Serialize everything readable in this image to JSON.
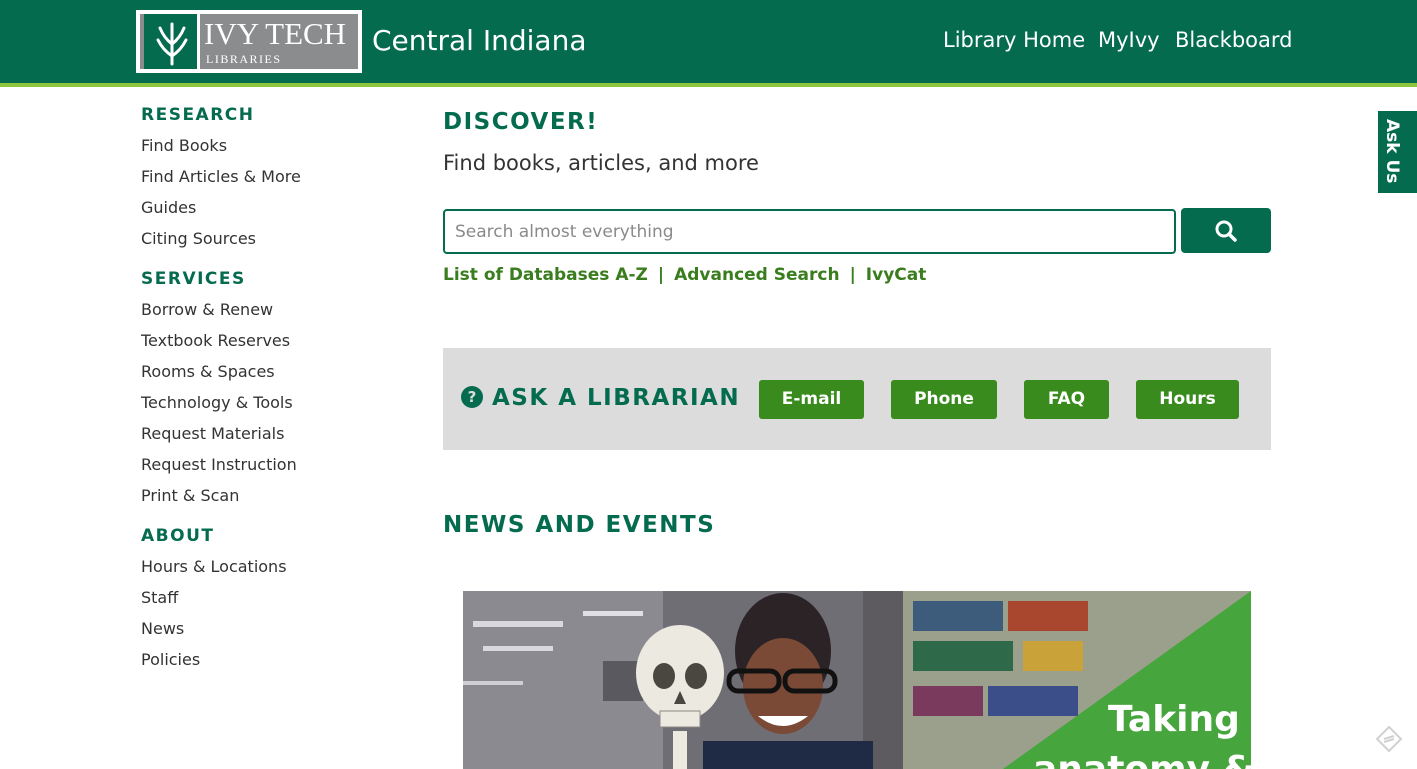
{
  "header": {
    "logo": {
      "name": "IVY TECH",
      "sub": "LIBRARIES"
    },
    "campus": "Central Indiana",
    "nav": [
      "Library Home",
      "MyIvy",
      "Blackboard"
    ]
  },
  "sidebar": {
    "research": {
      "heading": "RESEARCH",
      "items": [
        "Find Books",
        "Find Articles & More",
        "Guides",
        "Citing Sources"
      ]
    },
    "services": {
      "heading": "SERVICES",
      "items": [
        "Borrow & Renew",
        "Textbook Reserves",
        "Rooms & Spaces",
        "Technology & Tools",
        "Request Materials",
        "Request Instruction",
        "Print & Scan"
      ]
    },
    "about": {
      "heading": "ABOUT",
      "items": [
        "Hours & Locations",
        "Staff",
        "News",
        "Policies"
      ]
    }
  },
  "discover": {
    "title": "DISCOVER!",
    "subtitle": "Find books, articles, and more",
    "search_placeholder": "Search almost everything",
    "search_icon": "search-icon",
    "links": [
      "List of Databases A-Z",
      "Advanced Search",
      "IvyCat"
    ],
    "separator": "|"
  },
  "ask": {
    "icon": "question-circle-icon",
    "title": "ASK A LIBRARIAN",
    "buttons": [
      "E-mail",
      "Phone",
      "FAQ",
      "Hours"
    ]
  },
  "news": {
    "title": "NEWS AND EVENTS",
    "caption_line1": "Taking",
    "caption_line2": "anatomy &"
  },
  "side_tab": {
    "label": "Ask Us"
  },
  "colors": {
    "brand_green": "#046b4f",
    "accent_green": "#8cc63f",
    "button_green": "#3a8b1e",
    "panel_gray": "#dcdcdc"
  }
}
